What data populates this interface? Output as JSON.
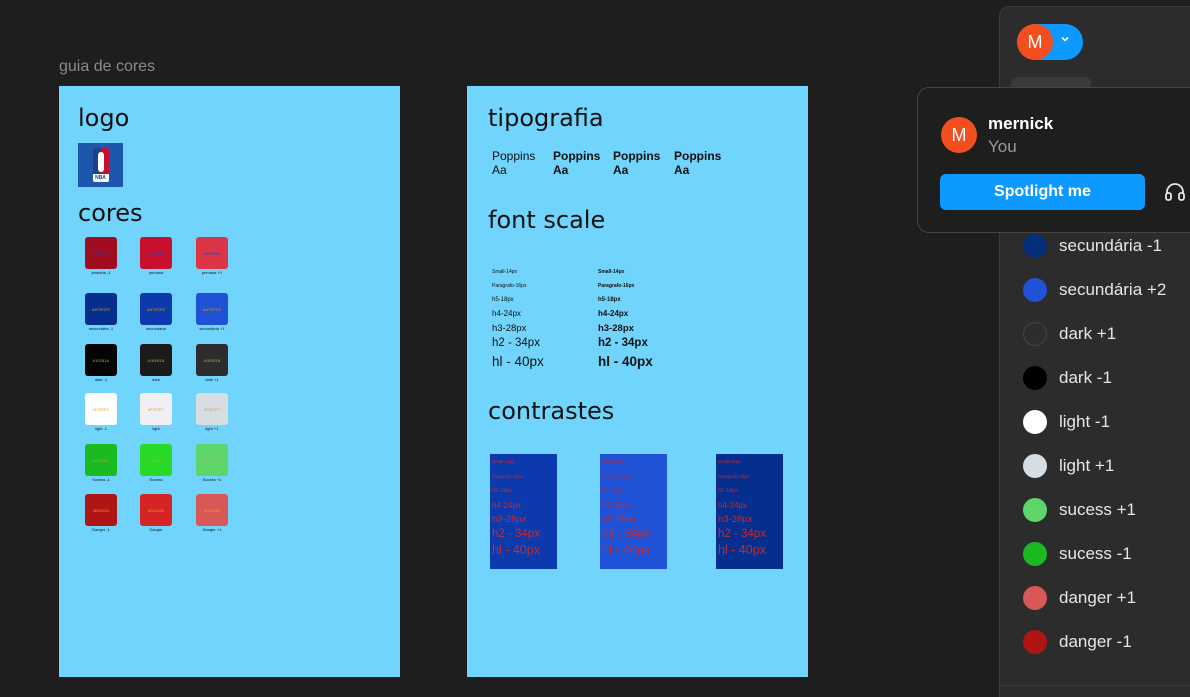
{
  "canvas": {
    "frame1_label": "guia de cores"
  },
  "frame1": {
    "logo_title": "logo",
    "logo_text": "NBA",
    "cores_title": "cores",
    "swatches": [
      {
        "hex": "#9C0F1B",
        "label": "primária -1",
        "color": "#a00d20",
        "hexcolor": "#2b3ea8"
      },
      {
        "hex": "#C8102E",
        "label": "primaria",
        "color": "#c8102e",
        "hexcolor": "#2b3ea8"
      },
      {
        "hex": "#D6323D",
        "label": "primária +1",
        "color": "#dc3545",
        "hexcolor": "#2b3ea8"
      },
      {
        "hex": "#1F2F2F2",
        "label": "secundária -1",
        "color": "#052e8e",
        "hexcolor": "#c8a020"
      },
      {
        "hex": "#1F2F2F2",
        "label": "secundaria",
        "color": "#0c3aad",
        "hexcolor": "#c8a020"
      },
      {
        "hex": "#1F2F2F2",
        "label": "secundária +1",
        "color": "#1f52d6",
        "hexcolor": "#c8a020"
      },
      {
        "hex": "#101B1A",
        "label": "dark -1",
        "color": "#050505",
        "hexcolor": "#c8a020"
      },
      {
        "hex": "#1B1B1B",
        "label": "dark",
        "color": "#1b1b1b",
        "hexcolor": "#c8a020"
      },
      {
        "hex": "#1B1B1B",
        "label": "dark +1",
        "color": "#2d2d2d",
        "hexcolor": "#c8a020"
      },
      {
        "hex": "#F2F2F7",
        "label": "light -1",
        "color": "#ffffff",
        "hexcolor": "#e0a030"
      },
      {
        "hex": "#F2F2F7",
        "label": "light",
        "color": "#f0f0f4",
        "hexcolor": "#e0a030"
      },
      {
        "hex": "#F2F2F7",
        "label": "light +1",
        "color": "#d6dde3",
        "hexcolor": "#e0a030"
      },
      {
        "hex": "#1EBD2F",
        "label": "Sucess -1",
        "color": "#1aba21",
        "hexcolor": "#c8a020"
      },
      {
        "hex": "#28E02E",
        "label": "Sucess",
        "color": "#28d928",
        "hexcolor": "#c8a020"
      },
      {
        "hex": "#57D962",
        "label": "Sucess +1",
        "color": "#5fd66a",
        "hexcolor": "#c8a020"
      },
      {
        "hex": "#B22424",
        "label": "Danger -1",
        "color": "#b01515",
        "hexcolor": "#e0a030"
      },
      {
        "hex": "#D22424",
        "label": "Danger",
        "color": "#d42424",
        "hexcolor": "#e0a030"
      },
      {
        "hex": "#D55050",
        "label": "Danger +1",
        "color": "#d85757",
        "hexcolor": "#e0a030"
      }
    ]
  },
  "frame2": {
    "tipografia_title": "tipografia",
    "fonts": [
      {
        "name": "Poppins",
        "sample": "Aa"
      },
      {
        "name": "Poppins",
        "sample": "Aa"
      },
      {
        "name": "Poppins",
        "sample": "Aa"
      },
      {
        "name": "Poppins",
        "sample": "Aa"
      }
    ],
    "font_scale_title": "font scale",
    "scale_items": [
      "Small-14px",
      "Paragrafo-16px",
      "h5-18px",
      "h4-24px",
      "h3-28px",
      "h2 - 34px",
      "hl - 40px"
    ],
    "contrastes_title": "contrastes",
    "contrast_boxes": [
      {
        "bg": "#0c3aad"
      },
      {
        "bg": "#1f52d6"
      },
      {
        "bg": "#052e8e"
      }
    ]
  },
  "user": {
    "initial": "M",
    "name": "mernick",
    "you_label": "You",
    "spotlight_label": "Spotlight me"
  },
  "color_styles": [
    {
      "label": "secundária -1",
      "color": "#052e7a"
    },
    {
      "label": "secundária +2",
      "color": "#1f52d6"
    },
    {
      "label": "dark +1",
      "color": "#2d2d2d"
    },
    {
      "label": "dark -1",
      "color": "#000000"
    },
    {
      "label": "light -1",
      "color": "#ffffff"
    },
    {
      "label": "light +1",
      "color": "#d6dde3"
    },
    {
      "label": "sucess +1",
      "color": "#5fd66a"
    },
    {
      "label": "sucess -1",
      "color": "#1aba21"
    },
    {
      "label": "danger +1",
      "color": "#d85757"
    },
    {
      "label": "danger -1",
      "color": "#b01515"
    }
  ]
}
